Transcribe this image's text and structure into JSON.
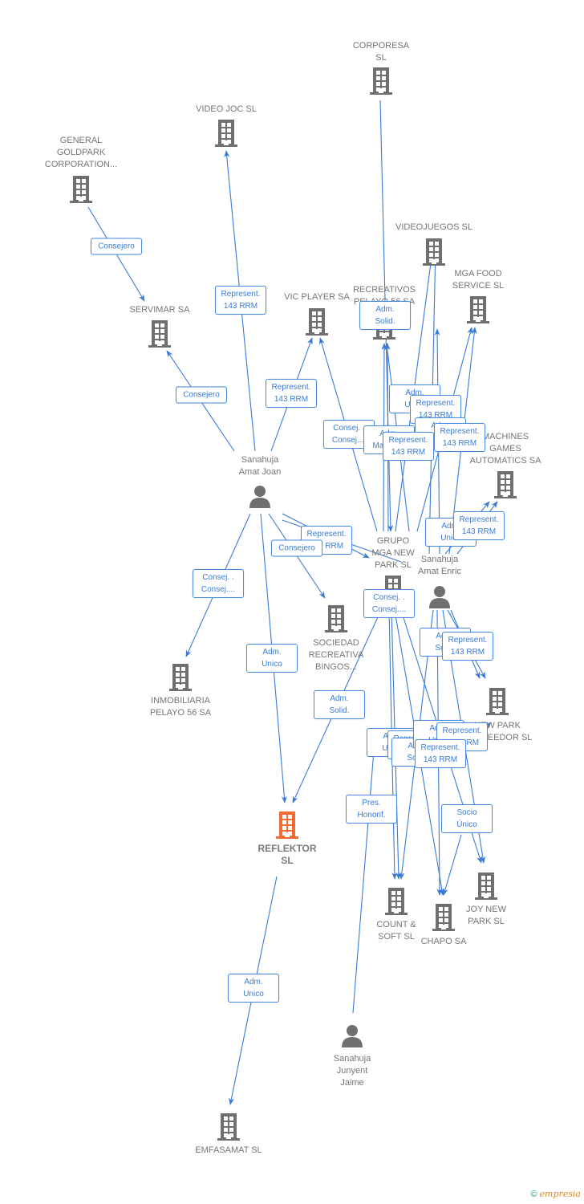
{
  "colors": {
    "edge": "#3a7bd5",
    "node": "#6f6f6f",
    "main_node": "#f26b35"
  },
  "nodes": [
    {
      "id": "corporesa",
      "type": "company",
      "label": "CORPORESA\nSL"
    },
    {
      "id": "video_joc",
      "type": "company",
      "label": "VIDEO JOC SL"
    },
    {
      "id": "general_goldpark",
      "type": "company",
      "label": "GENERAL\nGOLDPARK\nCORPORATION..."
    },
    {
      "id": "videojuegos",
      "type": "company",
      "label": "VIDEOJUEGOS SL"
    },
    {
      "id": "mga_food",
      "type": "company",
      "label": "MGA FOOD\nSERVICE  SL"
    },
    {
      "id": "recreativos",
      "type": "company",
      "label": "RECREATIVOS\nPELAYO 56 SA"
    },
    {
      "id": "vic_player",
      "type": "company",
      "label": "VIC PLAYER SA"
    },
    {
      "id": "servimar",
      "type": "company",
      "label": "SERVIMAR SA"
    },
    {
      "id": "machines",
      "type": "company",
      "label": "MACHINES\nGAMES\nAUTOMATICS SA"
    },
    {
      "id": "grupo_mga",
      "type": "company",
      "label": "GRUPO\nMGA NEW\nPARK SL"
    },
    {
      "id": "joan",
      "type": "person",
      "label": "Sanahuja\nAmat Joan"
    },
    {
      "id": "enric",
      "type": "person",
      "label": "Sanahuja\nAmat Enric"
    },
    {
      "id": "sociedad",
      "type": "company",
      "label": "SOCIEDAD\nRECREATIVA\nBINGOS..."
    },
    {
      "id": "inmobiliaria",
      "type": "company",
      "label": "INMOBILIARIA\nPELAYO 56 SA"
    },
    {
      "id": "new_park",
      "type": "company",
      "label": "NEW PARK\nPROVEEDOR SL"
    },
    {
      "id": "reflektor",
      "type": "main",
      "label": "REFLEKTOR\nSL"
    },
    {
      "id": "count_soft",
      "type": "company",
      "label": "COUNT &\nSOFT SL"
    },
    {
      "id": "chapo",
      "type": "company",
      "label": "CHAPO SA"
    },
    {
      "id": "joy",
      "type": "company",
      "label": "JOY NEW\nPARK SL"
    },
    {
      "id": "jaime",
      "type": "person",
      "label": "Sanahuja\nJunyent\nJaime"
    },
    {
      "id": "emfasamat",
      "type": "company",
      "label": "EMFASAMAT SL"
    }
  ],
  "relations": [
    "Consejero",
    "Represent.\n143 RRM",
    "Adm.\nSolid.",
    "Consejero",
    "Represent.\n143 RRM",
    "Adm.\nUnico",
    "Represent.\n143 RRM",
    "Consej. .\nConsej....",
    "Adm.\nMancom.",
    "Adm.\nUnico",
    "Represent.\n143 RRM",
    "Represent.\n143 RRM",
    "Adm.\nUnico",
    "Represent.\n143 RRM",
    "Represent.\n143 RRM",
    "Consejero",
    "Consej. .\nConsej....",
    "Consej. .\nConsej....",
    "Adm.\nSolid.",
    "Represent.\n143 RRM",
    "Adm.\nUnico",
    "Adm.\nSolid.",
    "Adm.\nUnico",
    "Represent.\n143 RRM",
    "Adm.\nSolid.",
    "Adm.\nUnico",
    "Represent.\n143 RRM",
    "Represent.\n143 RRM",
    "Pres.\nHonorif.",
    "Socio\nÚnico",
    "Adm.\nUnico"
  ],
  "footer": {
    "copyright": "©",
    "brand": "empresia"
  }
}
